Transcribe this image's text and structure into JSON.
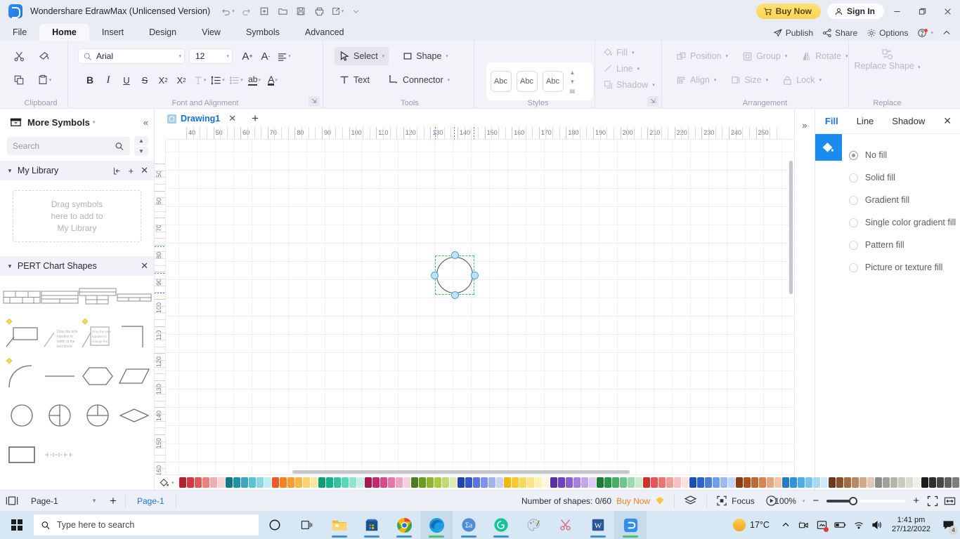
{
  "titlebar": {
    "app_title": "Wondershare EdrawMax (Unlicensed Version)",
    "quick_access": [
      "undo-icon",
      "redo-icon",
      "new-icon",
      "open-icon",
      "save-icon",
      "print-icon",
      "export-icon",
      "more-icon"
    ],
    "buy_now": "Buy Now",
    "sign_in": "Sign In",
    "window_buttons": [
      "minimize",
      "restore",
      "close"
    ]
  },
  "menubar": {
    "items": [
      "File",
      "Home",
      "Insert",
      "Design",
      "View",
      "Symbols",
      "Advanced"
    ],
    "active": "Home",
    "right_items": [
      "Publish",
      "Share",
      "Options"
    ],
    "help_icon": "help-icon",
    "collapse_icon": "chevron-up-icon"
  },
  "ribbon": {
    "clipboard": {
      "label": "Clipboard",
      "items": [
        "cut-icon",
        "format-painter-icon",
        "copy-icon",
        "paste-icon"
      ]
    },
    "font": {
      "label": "Font and Alignment",
      "font_family": "Arial",
      "font_family_placeholder": "Arial",
      "font_size": "12",
      "buttons": [
        "grow-font",
        "shrink-font",
        "align",
        "bold",
        "italic",
        "underline",
        "strikethrough",
        "superscript",
        "subscript",
        "text-effects",
        "line-spacing",
        "bullets",
        "text-case",
        "font-color"
      ]
    },
    "tools": {
      "label": "Tools",
      "select": "Select",
      "shape": "Shape",
      "text": "Text",
      "connector": "Connector"
    },
    "styles": {
      "label": "Styles",
      "previews": [
        "Abc",
        "Abc",
        "Abc"
      ]
    },
    "fill_group": {
      "fill": "Fill",
      "line": "Line",
      "shadow": "Shadow"
    },
    "arrangement": {
      "label": "Arrangement",
      "items": [
        "Position",
        "Group",
        "Rotate",
        "Align",
        "Size",
        "Lock"
      ]
    },
    "replace": {
      "label": "Replace",
      "button": "Replace Shape"
    }
  },
  "left_panel": {
    "header": "More Symbols",
    "search_placeholder": "Search",
    "search_value": "",
    "my_library": {
      "title": "My Library",
      "drop_text": "Drag symbols\nhere to add to\nMy Library"
    },
    "pert": {
      "title": "PERT Chart Shapes"
    }
  },
  "canvas": {
    "tab_name": "Drawing1",
    "h_ruler_labels": [
      "40",
      "50",
      "60",
      "70",
      "80",
      "90",
      "100",
      "110",
      "120",
      "130",
      "140",
      "150",
      "160",
      "170",
      "180",
      "190",
      "200",
      "210",
      "220",
      "230",
      "240",
      "250"
    ],
    "v_ruler_labels": [
      "50",
      "60",
      "70",
      "80",
      "90",
      "100",
      "110",
      "120",
      "130",
      "140",
      "150",
      "160"
    ],
    "shape": "circle"
  },
  "right_panel": {
    "tabs": [
      "Fill",
      "Line",
      "Shadow"
    ],
    "active_tab": "Fill",
    "fill_options": [
      "No fill",
      "Solid fill",
      "Gradient fill",
      "Single color gradient fill",
      "Pattern fill",
      "Picture or texture fill"
    ],
    "selected_option": "No fill",
    "accent_color": "#1a73e8"
  },
  "statusbar": {
    "page_select": "Page-1",
    "page_tab": "Page-1",
    "shapes_count": "Number of shapes: 0/60",
    "buy_now": "Buy Now",
    "focus": "Focus",
    "zoom": "100%"
  },
  "taskbar": {
    "search_placeholder": "Type here to search",
    "temperature": "17°C",
    "time": "1:41 pm",
    "date": "27/12/2022",
    "notification_count": "4",
    "apps": [
      "cortana-icon",
      "task-view-icon",
      "file-explorer-icon",
      "microsoft-store-icon",
      "google-chrome-icon",
      "microsoft-edge-icon",
      "translator-icon",
      "grammarly-icon",
      "paint-icon",
      "snip-icon",
      "word-icon",
      "edrawmax-icon"
    ]
  },
  "palette": {
    "colors": [
      "#b51f2e",
      "#d13b3f",
      "#e05a58",
      "#ea8080",
      "#f0aeb0",
      "#f6d2d3",
      "#11788c",
      "#2291a6",
      "#35a9bd",
      "#58c2d4",
      "#8bd8e5",
      "#c4ecf3",
      "#f05a28",
      "#f7821e",
      "#f99d33",
      "#fab64a",
      "#fcd06c",
      "#fde5a3",
      "#0e9e72",
      "#16b185",
      "#2ec6a0",
      "#5ad8b9",
      "#8ee5ce",
      "#c4f0e4",
      "#a8184a",
      "#c12a6c",
      "#d9498c",
      "#e874aa",
      "#f0a0c6",
      "#f7cede",
      "#4a7d1e",
      "#6b9c22",
      "#8fb72d",
      "#aac947",
      "#c3da73",
      "#dfeab0",
      "#2342b5",
      "#3657c9",
      "#5a74dc",
      "#7e93e6",
      "#a3b1ee",
      "#c9d2f6",
      "#f2b705",
      "#f7c92c",
      "#fad95a",
      "#fbe587",
      "#fdf0b3",
      "#fef7da",
      "#5a2ea6",
      "#7141bd",
      "#8b5dd1",
      "#a67fe0",
      "#c2a5ec",
      "#dcc9f5",
      "#1b7a37",
      "#2a9648",
      "#45b063",
      "#72c589",
      "#9cd9ab",
      "#c8ead1",
      "#d32f2f",
      "#e65454",
      "#ed7474",
      "#f39b9b",
      "#f8c0c0",
      "#fce0e0",
      "#1a4fb5",
      "#2a65cc",
      "#4a80dc",
      "#719ce8",
      "#9bbaf1",
      "#c6d6f8",
      "#8a3d12",
      "#a85320",
      "#c2692f",
      "#d5854f",
      "#e5a77b",
      "#f1c7aa",
      "#1d7fc7",
      "#2f95d8",
      "#4fade6",
      "#79c4ef",
      "#a5d9f5",
      "#cdeafb",
      "#6b3a1e",
      "#87522c",
      "#a36b3f",
      "#bb8862",
      "#d0a98b",
      "#e3c9b5",
      "#8d8d8d",
      "#a2a29a",
      "#b6b6ab",
      "#c9c9c0",
      "#dbdbd4",
      "#efefe9",
      "#1b1b1b",
      "#2e2e2e",
      "#474747",
      "#616161",
      "#7d7d7d",
      "#9c9c9c",
      "#b9b9b9",
      "#d2d2d2",
      "#e4e4e4",
      "#f2f2f2"
    ]
  }
}
